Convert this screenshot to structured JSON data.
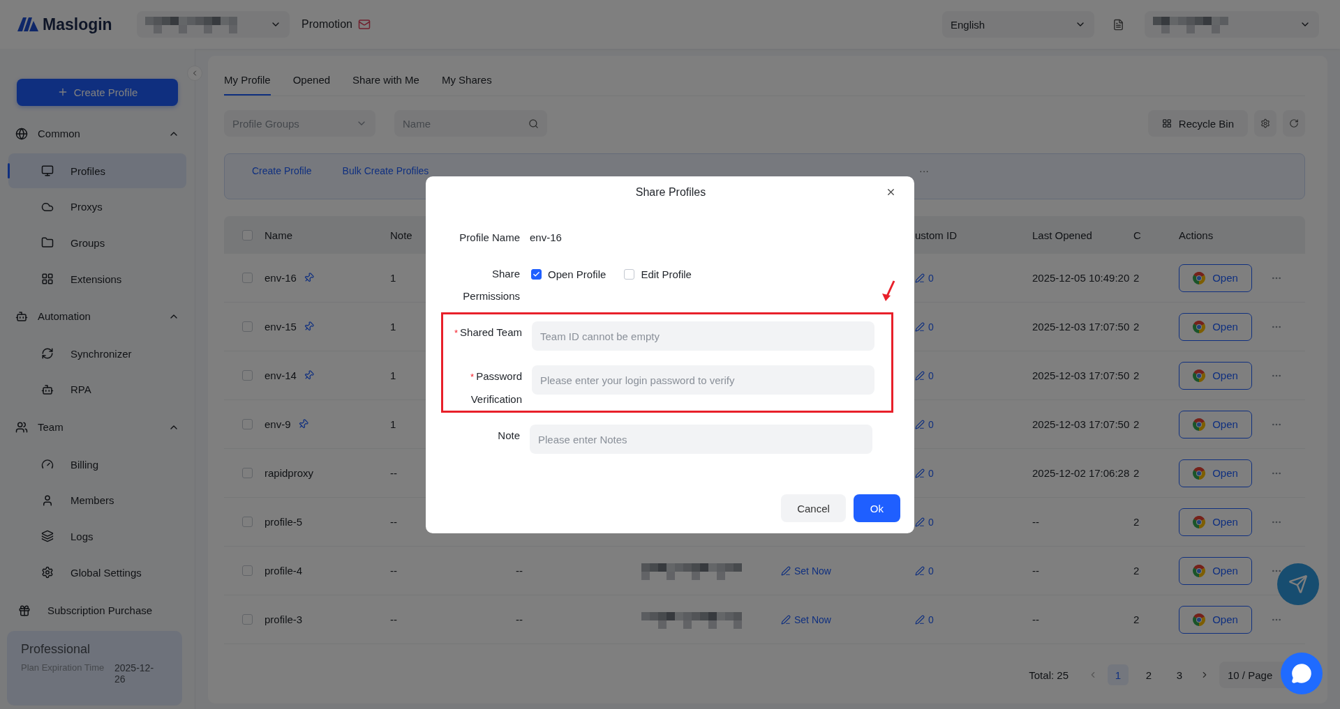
{
  "header": {
    "logo": "Maslogin",
    "promotion": "Promotion",
    "language": "English"
  },
  "sidebar": {
    "create_button": "Create Profile",
    "sections": [
      {
        "title": "Common",
        "expanded": true,
        "items": [
          {
            "label": "Profiles",
            "selected": true
          },
          {
            "label": "Proxys",
            "selected": false
          },
          {
            "label": "Groups",
            "selected": false
          },
          {
            "label": "Extensions",
            "selected": false
          }
        ]
      },
      {
        "title": "Automation",
        "expanded": true,
        "items": [
          {
            "label": "Synchronizer",
            "selected": false
          },
          {
            "label": "RPA",
            "selected": false
          }
        ]
      },
      {
        "title": "Team",
        "expanded": true,
        "items": [
          {
            "label": "Billing",
            "selected": false
          },
          {
            "label": "Members",
            "selected": false
          },
          {
            "label": "Logs",
            "selected": false
          },
          {
            "label": "Global Settings",
            "selected": false
          }
        ]
      }
    ],
    "subscription": "Subscription Purchase",
    "plan": {
      "name": "Professional",
      "label": "Plan Expiration Time",
      "value": "2025-12-26"
    }
  },
  "tabs": [
    {
      "label": "My Profile",
      "selected": true
    },
    {
      "label": "Opened",
      "selected": false
    },
    {
      "label": "Share with Me",
      "selected": false
    },
    {
      "label": "My Shares",
      "selected": false
    }
  ],
  "filters": {
    "group_placeholder": "Profile Groups",
    "search_placeholder": "Name",
    "recycle_bin": "Recycle Bin"
  },
  "actions": [
    "Create Profile",
    "Bulk Create Profiles",
    "···"
  ],
  "table": {
    "all_checked": false,
    "columns": {
      "name": "Name",
      "note": "Note",
      "custom_id": "ustom ID",
      "last_opened": "Last Opened",
      "column_9": "C",
      "actions": "Actions"
    },
    "rows": [
      {
        "checked": false,
        "name": "env-16",
        "pinned": true,
        "note": "1",
        "custom_id": "0",
        "last_opened": "2025-12-05 10:49:20",
        "column_9": "2",
        "action": "Open"
      },
      {
        "checked": false,
        "name": "env-15",
        "pinned": true,
        "note": "1",
        "custom_id": "0",
        "last_opened": "2025-12-03 17:07:50",
        "column_9": "2",
        "action": "Open"
      },
      {
        "checked": false,
        "name": "env-14",
        "pinned": true,
        "note": "1",
        "custom_id": "0",
        "last_opened": "2025-12-03 17:07:50",
        "column_9": "2",
        "action": "Open"
      },
      {
        "checked": false,
        "name": "env-9",
        "pinned": true,
        "note": "1",
        "custom_id": "0",
        "last_opened": "2025-12-03 17:07:50",
        "column_9": "2",
        "action": "Open"
      },
      {
        "checked": false,
        "name": "rapidproxy",
        "pinned": false,
        "note": "--",
        "custom_id": "0",
        "last_opened": "2025-12-02 17:06:28",
        "column_9": "2",
        "action": "Open"
      },
      {
        "checked": false,
        "name": "profile-5",
        "pinned": false,
        "note": "--",
        "custom_id": "0",
        "last_opened": "--",
        "column_9": "2",
        "action": "Open"
      },
      {
        "checked": false,
        "name": "profile-4",
        "pinned": false,
        "note": "--",
        "column_3": "--",
        "column_4": {
          "kind": "pixelated"
        },
        "column_5": "Set Now",
        "custom_id": "0",
        "last_opened": "--",
        "column_9": "2",
        "action": "Open"
      },
      {
        "checked": false,
        "name": "profile-3",
        "pinned": false,
        "note": "--",
        "column_3": "--",
        "column_4": {
          "kind": "pixelated"
        },
        "column_5": "Set Now",
        "custom_id": "0",
        "last_opened": "--",
        "column_9": "2",
        "action": "Open"
      }
    ]
  },
  "pagination": {
    "total": "Total: 25",
    "pages": [
      {
        "label": "1",
        "selected": true
      },
      {
        "label": "2",
        "selected": false
      },
      {
        "label": "3",
        "selected": false
      }
    ],
    "page_size": "10 / Page"
  },
  "modal": {
    "title": "Share Profiles",
    "required_mark": "*",
    "fields": [
      {
        "kind": "text",
        "label": "Profile Name",
        "value": "env-16",
        "highlighted": false
      },
      {
        "kind": "checks",
        "label": "Share Permissions",
        "highlighted": false,
        "options": [
          {
            "label": "Open Profile",
            "checked": true
          },
          {
            "label": "Edit Profile",
            "checked": false
          }
        ]
      },
      {
        "kind": "input",
        "label": "Shared Team",
        "required": true,
        "placeholder": "Team ID cannot be empty",
        "highlighted": true
      },
      {
        "kind": "input",
        "label": "Password Verification",
        "required": true,
        "placeholder": "Please enter your login password to verify",
        "highlighted": true
      },
      {
        "kind": "input",
        "label": "Note",
        "required": false,
        "placeholder": "Please enter Notes",
        "highlighted": false
      }
    ],
    "buttons": [
      {
        "label": "Cancel",
        "kind": "secondary"
      },
      {
        "label": "Ok",
        "kind": "primary"
      }
    ]
  }
}
